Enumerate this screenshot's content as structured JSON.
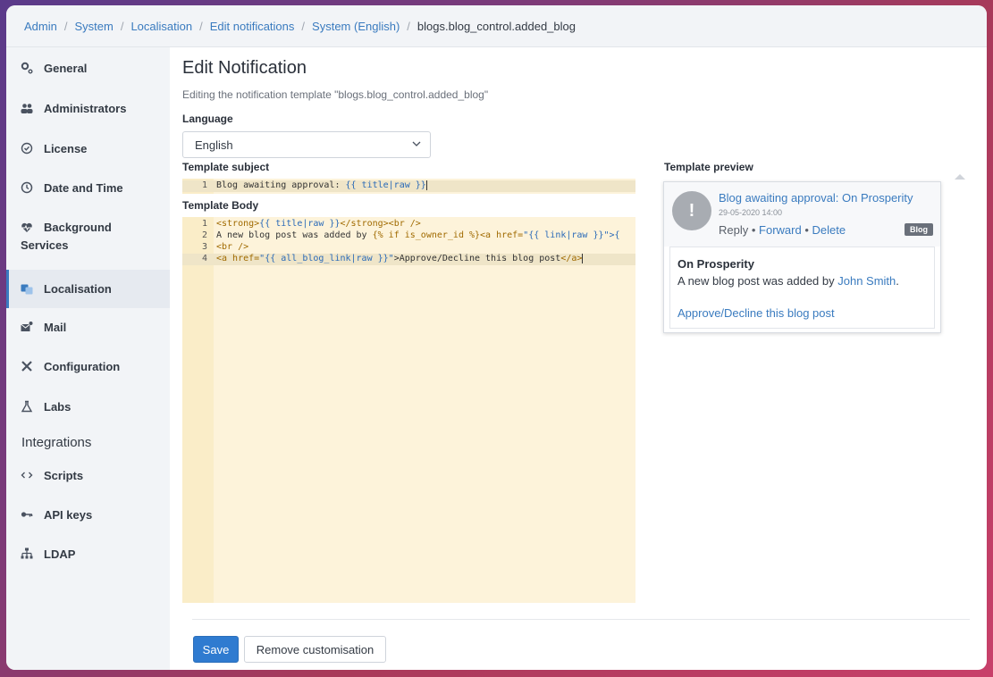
{
  "breadcrumb": {
    "items": [
      "Admin",
      "System",
      "Localisation",
      "Edit notifications",
      "System (English)"
    ],
    "current": "blogs.blog_control.added_blog"
  },
  "sidebar": {
    "items": [
      {
        "label": "General",
        "icon": "gears-icon"
      },
      {
        "label": "Administrators",
        "icon": "users-icon"
      },
      {
        "label": "License",
        "icon": "badge-icon"
      },
      {
        "label": "Date and Time",
        "icon": "clock-icon"
      },
      {
        "label": "Background",
        "label2": "Services",
        "icon": "heartbeat-icon"
      },
      {
        "label": "Localisation",
        "icon": "language-icon",
        "active": true
      },
      {
        "label": "Mail",
        "icon": "mail-icon"
      },
      {
        "label": "Configuration",
        "icon": "tools-icon"
      },
      {
        "label": "Labs",
        "icon": "flask-icon"
      }
    ],
    "heading": "Integrations",
    "items2": [
      {
        "label": "Scripts",
        "icon": "code-icon"
      },
      {
        "label": "API keys",
        "icon": "key-icon"
      },
      {
        "label": "LDAP",
        "icon": "sitemap-icon"
      }
    ]
  },
  "main": {
    "title": "Edit Notification",
    "subtitle": "Editing the notification template \"blogs.blog_control.added_blog\"",
    "language_label": "Language",
    "language_value": "English",
    "subject_label": "Template subject",
    "body_label": "Template Body",
    "preview_label": "Template preview"
  },
  "subject_code": {
    "num": "1",
    "plain": "Blog awaiting approval: ",
    "expr": "{{ title|raw }}"
  },
  "body_code": [
    {
      "num": "1",
      "parts": [
        "<strong>",
        "{{ title|raw }}",
        "</strong><br />"
      ]
    },
    {
      "num": "2",
      "parts": [
        "A new blog post was added by ",
        "{% if is_owner_id %}",
        "<a href=",
        "\"{{ link|raw }}\">{"
      ]
    },
    {
      "num": "3",
      "parts": [
        "<br />"
      ]
    },
    {
      "num": "4",
      "parts": [
        "<a href=",
        "\"{{ all_blog_link|raw }}\"",
        ">Approve/Decline this blog post",
        "</a>"
      ]
    }
  ],
  "preview": {
    "avatar_glyph": "!",
    "title": "Blog awaiting approval: On Prosperity",
    "date": "29-05-2020 14:00",
    "reply": "Reply",
    "dot": " • ",
    "forward": "Forward",
    "delete": "Delete",
    "badge": "Blog",
    "body_title": "On Prosperity",
    "body_text": "A new blog post was added by ",
    "body_author": "John Smith",
    "body_period": ".",
    "body_link": "Approve/Decline this blog post"
  },
  "actions": {
    "save": "Save",
    "remove": "Remove customisation"
  },
  "colors": {
    "accent": "#3a7bbf",
    "primary_button": "#2f7bd0",
    "code_bg": "#fdf3da"
  }
}
